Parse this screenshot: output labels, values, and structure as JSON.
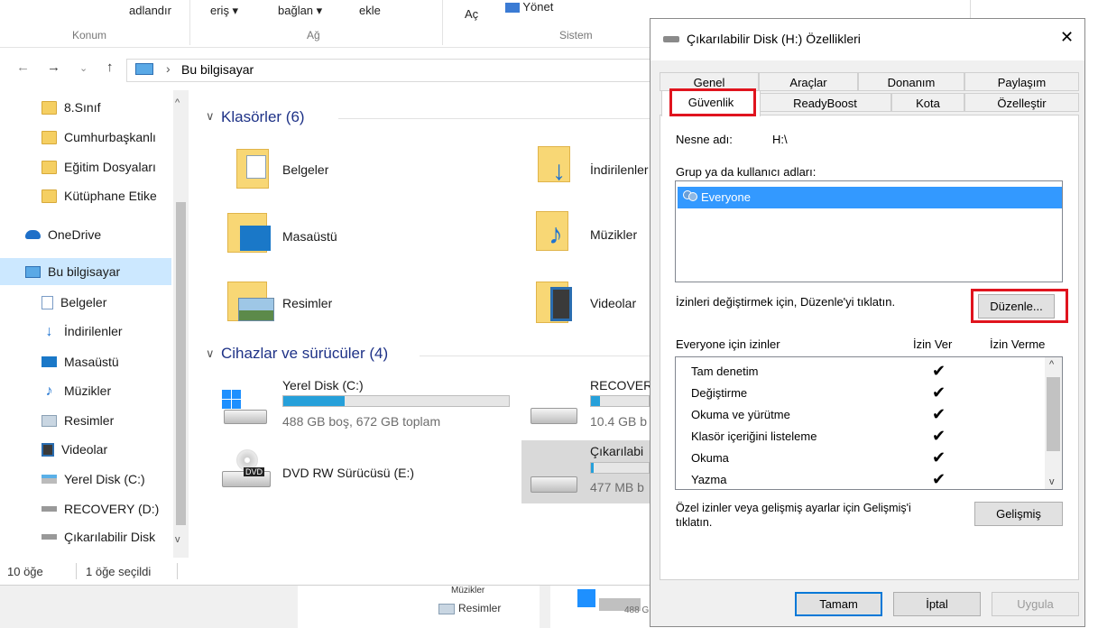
{
  "ribbon": {
    "items": [
      "adlandır",
      "eriş ▾",
      "bağlan ▾",
      "ekle",
      "Aç",
      "Yönet"
    ],
    "groups": [
      "Konum",
      "Ağ",
      "Sistem"
    ]
  },
  "address": {
    "path": "Bu bilgisayar",
    "separator": "›"
  },
  "nav": {
    "items": [
      {
        "label": "8.Sınıf",
        "icon": "folder-icon"
      },
      {
        "label": "Cumhurbaşkanlı",
        "icon": "folder-icon"
      },
      {
        "label": "Eğitim Dosyaları",
        "icon": "folder-icon"
      },
      {
        "label": "Kütüphane Etike",
        "icon": "folder-icon"
      },
      {
        "label": "OneDrive",
        "icon": "cloud-icon"
      },
      {
        "label": "Bu bilgisayar",
        "icon": "computer-icon"
      },
      {
        "label": "Belgeler",
        "icon": "documents-icon"
      },
      {
        "label": "İndirilenler",
        "icon": "download-icon"
      },
      {
        "label": "Masaüstü",
        "icon": "desktop-icon"
      },
      {
        "label": "Müzikler",
        "icon": "music-icon"
      },
      {
        "label": "Resimler",
        "icon": "pictures-icon"
      },
      {
        "label": "Videolar",
        "icon": "video-icon"
      },
      {
        "label": "Yerel Disk (C:)",
        "icon": "drive-icon"
      },
      {
        "label": "RECOVERY (D:)",
        "icon": "drive-icon"
      },
      {
        "label": "Çıkarılabilir Disk",
        "icon": "removable-drive-icon"
      }
    ]
  },
  "content": {
    "folders_header": "Klasörler (6)",
    "folders": [
      "Belgeler",
      "İndirilenler",
      "Masaüstü",
      "Müzikler",
      "Resimler",
      "Videolar"
    ],
    "devices_header": "Cihazlar ve sürücüler (4)",
    "devices": [
      {
        "name": "Yerel Disk (C:)",
        "info": "488 GB boş, 672 GB toplam",
        "used": 0.27
      },
      {
        "name": "RECOVERY",
        "info": "10.4 GB b",
        "used": 0.15
      },
      {
        "name": "DVD RW Sürücüsü (E:)",
        "info": "",
        "used": null
      },
      {
        "name": "Çıkarılabi",
        "info": "477 MB b",
        "used": 0.05
      }
    ]
  },
  "status": {
    "count": "10 öğe",
    "selected": "1 öğe seçildi"
  },
  "background_bottom": {
    "label_music": "Müzikler",
    "label_pictures": "Resimler",
    "label_size": "488 G"
  },
  "dialog": {
    "title": "Çıkarılabilir Disk (H:) Özellikleri",
    "close": "✕",
    "tabs_row1": [
      "Genel",
      "Araçlar",
      "Donanım",
      "Paylaşım"
    ],
    "tabs_row2": [
      "Güvenlik",
      "ReadyBoost",
      "Kota",
      "Özelleştir"
    ],
    "object_name_label": "Nesne adı:",
    "object_name_value": "H:\\",
    "group_label": "Grup ya da kullanıcı adları:",
    "groups": [
      "Everyone"
    ],
    "edit_hint": "İzinleri değiştirmek için, Düzenle'yi tıklatın.",
    "edit_button": "Düzenle...",
    "perm_header": "Everyone için izinler",
    "allow_header": "İzin Ver",
    "deny_header": "İzin Verme",
    "permissions": [
      {
        "name": "Tam denetim",
        "allow": true
      },
      {
        "name": "Değiştirme",
        "allow": true
      },
      {
        "name": "Okuma ve yürütme",
        "allow": true
      },
      {
        "name": "Klasör içeriğini listeleme",
        "allow": true
      },
      {
        "name": "Okuma",
        "allow": true
      },
      {
        "name": "Yazma",
        "allow": true
      }
    ],
    "check_mark": "✔",
    "advanced_hint_line1": "Özel izinler veya gelişmiş ayarlar için Gelişmiş'i",
    "advanced_hint_line2": "tıklatın.",
    "advanced_button": "Gelişmiş",
    "ok_button": "Tamam",
    "cancel_button": "İptal",
    "apply_button": "Uygula"
  },
  "colors": {
    "accent": "#3399ff",
    "highlight": "#e0141e",
    "nav_selected": "#cce8ff"
  }
}
